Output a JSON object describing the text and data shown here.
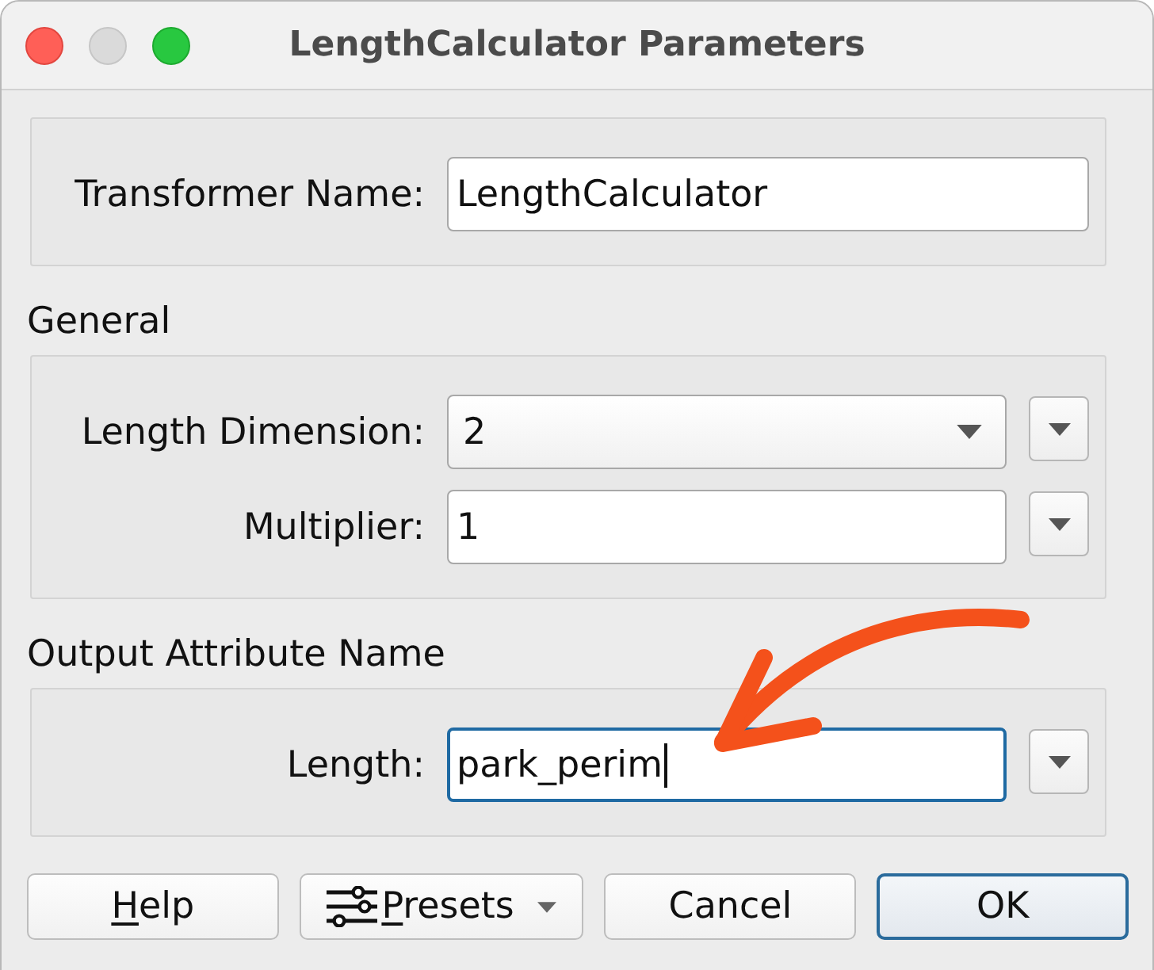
{
  "window": {
    "title": "LengthCalculator Parameters",
    "traffic_lights": [
      {
        "kind": "close",
        "disabled": false
      },
      {
        "kind": "minimize",
        "disabled": true
      },
      {
        "kind": "zoom",
        "disabled": false
      }
    ]
  },
  "groups": [
    {
      "rows": [
        {
          "label": "Transformer Name:",
          "kind": "text",
          "value": "LengthCalculator",
          "focused": false,
          "menu_button": false
        }
      ]
    },
    {
      "title": "General",
      "rows": [
        {
          "label": "Length Dimension:",
          "kind": "dropdown",
          "value": "2",
          "focused": false,
          "menu_button": true
        },
        {
          "label": "Multiplier:",
          "kind": "text",
          "value": "1",
          "focused": false,
          "menu_button": true
        }
      ]
    },
    {
      "title": "Output Attribute Name",
      "rows": [
        {
          "label": "Length:",
          "kind": "text",
          "value": "park_perim",
          "focused": true,
          "menu_button": true
        }
      ]
    }
  ],
  "buttons": [
    {
      "kind": "plain",
      "label": "Help",
      "access_key_underlined": true,
      "default": false
    },
    {
      "kind": "menu",
      "label": "Presets",
      "access_key_underlined": true,
      "default": false
    },
    {
      "kind": "plain",
      "label": "Cancel",
      "access_key_underlined": false,
      "default": false
    },
    {
      "kind": "plain",
      "label": "OK",
      "access_key_underlined": false,
      "default": true
    }
  ],
  "annotations": [
    {
      "kind": "arrow"
    }
  ]
}
